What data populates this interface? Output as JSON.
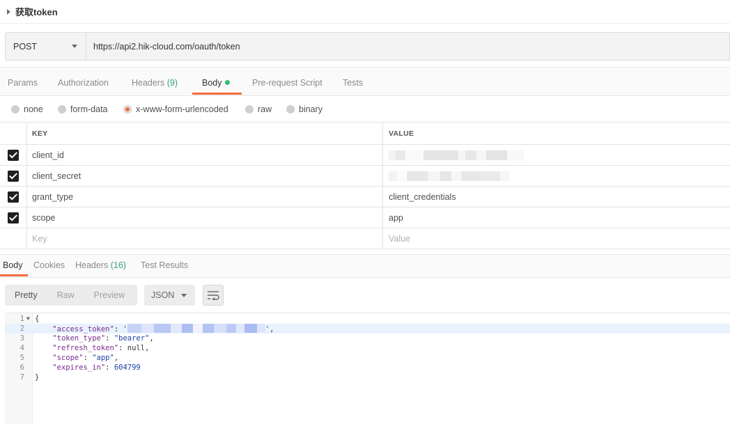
{
  "request": {
    "name": "获取token",
    "method": "POST",
    "url": "https://api2.hik-cloud.com/oauth/token"
  },
  "request_tabs": {
    "params": "Params",
    "authorization": "Authorization",
    "headers": "Headers",
    "headers_count": "(9)",
    "body": "Body",
    "pre_request": "Pre-request Script",
    "tests": "Tests"
  },
  "body_types": {
    "none": "none",
    "form_data": "form-data",
    "urlencoded": "x-www-form-urlencoded",
    "raw": "raw",
    "binary": "binary",
    "selected": "x-www-form-urlencoded"
  },
  "params_table": {
    "key_header": "KEY",
    "value_header": "VALUE",
    "rows": [
      {
        "key": "client_id",
        "value": "",
        "checked": true
      },
      {
        "key": "client_secret",
        "value": "",
        "checked": true
      },
      {
        "key": "grant_type",
        "value": "client_credentials",
        "checked": true
      },
      {
        "key": "scope",
        "value": "app",
        "checked": true
      }
    ],
    "key_placeholder": "Key",
    "value_placeholder": "Value"
  },
  "response_tabs": {
    "body": "Body",
    "cookies": "Cookies",
    "headers": "Headers",
    "headers_count": "(16)",
    "test_results": "Test Results"
  },
  "response_toolbar": {
    "pretty": "Pretty",
    "raw": "Raw",
    "preview": "Preview",
    "format": "JSON"
  },
  "response_json": {
    "line_numbers": [
      "1",
      "2",
      "3",
      "4",
      "5",
      "6",
      "7"
    ],
    "open_brace": "{",
    "close_brace": "}",
    "access_token_key": "\"access_token\"",
    "token_type_key": "\"token_type\"",
    "token_type_value": "\"bearer\"",
    "refresh_token_key": "\"refresh_token\"",
    "refresh_token_value": "null",
    "scope_key": "\"scope\"",
    "scope_value": "\"app\"",
    "expires_in_key": "\"expires_in\"",
    "expires_in_value": "604799"
  },
  "colors": {
    "accent": "#f26b3a",
    "success_dot": "#2fbf71",
    "count_text": "#3aa07a"
  }
}
